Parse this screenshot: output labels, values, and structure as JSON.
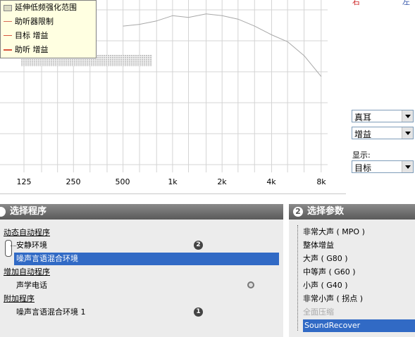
{
  "legend": {
    "items": [
      {
        "label": "延伸低频强化范围"
      },
      {
        "label": "助听器限制"
      },
      {
        "label": "目标 增益"
      },
      {
        "label": "助听 增益"
      }
    ]
  },
  "top_right": {
    "left_label": "右",
    "right_label": "左"
  },
  "dropdowns": {
    "ear": "真耳",
    "mode": "增益",
    "show_label": "显示:",
    "show_value": "目标"
  },
  "program_panel": {
    "number": "",
    "title": "选择程序",
    "groups": [
      {
        "label": "动态自动程序",
        "items": [
          {
            "label": "安静环境",
            "badge": "2"
          },
          {
            "label": "噪声言语混合环境",
            "selected": true
          }
        ]
      },
      {
        "label": "增加自动程序",
        "items": [
          {
            "label": "声学电话"
          }
        ]
      },
      {
        "label": "附加程序",
        "items": [
          {
            "label": "噪声言语混合环境 1",
            "badge": "1"
          }
        ]
      }
    ]
  },
  "param_panel": {
    "number": "2",
    "title": "选择参数",
    "items": [
      {
        "label": "非常大声 ( MPO )"
      },
      {
        "label": "整体增益"
      },
      {
        "label": "大声 ( G80 )"
      },
      {
        "label": "中等声 ( G60 )"
      },
      {
        "label": "小声 ( G40 )"
      },
      {
        "label": "非常小声 ( 拐点 )"
      },
      {
        "label": "全面压缩",
        "disabled": true
      },
      {
        "label": "SoundRecover",
        "selected": true
      }
    ]
  },
  "chart_data": {
    "type": "line",
    "x": [
      125,
      160,
      200,
      250,
      315,
      400,
      500,
      630,
      800,
      1000,
      1250,
      1600,
      2000,
      2500,
      3150,
      4000,
      5000,
      6300,
      8000
    ],
    "x_tick_labels": [
      "125",
      "250",
      "500",
      "1k",
      "2k",
      "4k",
      "8k"
    ],
    "x_scale": "log",
    "series": [
      {
        "name": "助听器限制",
        "values": [
          null,
          null,
          null,
          null,
          null,
          null,
          87,
          88,
          90,
          93,
          92,
          94,
          93,
          91,
          87,
          82,
          78,
          70,
          58
        ]
      },
      {
        "name": "目标 增益",
        "values": [
          null,
          null,
          null,
          null,
          null,
          null,
          null,
          null,
          null,
          null,
          null,
          null,
          null,
          null,
          null,
          null,
          null,
          null,
          null
        ]
      },
      {
        "name": "助听 增益",
        "values": [
          null,
          null,
          null,
          null,
          null,
          null,
          null,
          null,
          null,
          null,
          null,
          null,
          null,
          null,
          null,
          null,
          null,
          null,
          null
        ]
      }
    ],
    "grid": true,
    "legend_position": "top-left"
  }
}
